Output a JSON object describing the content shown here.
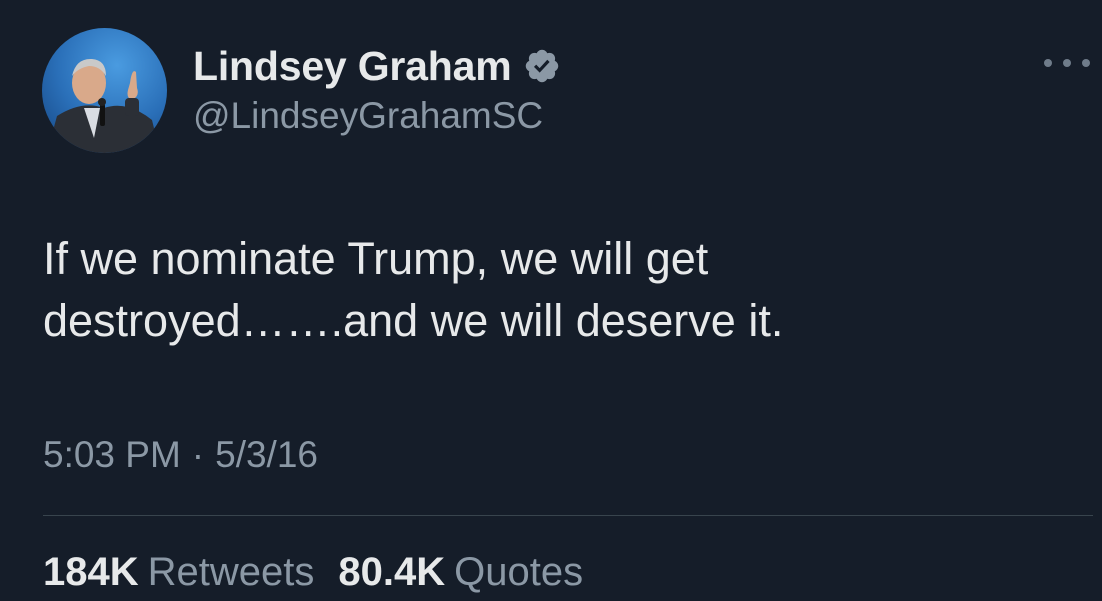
{
  "author": {
    "display_name": "Lindsey Graham",
    "handle": "@LindseyGrahamSC",
    "verified": true
  },
  "tweet": {
    "text": "If we nominate Trump, we will get\ndestroyed…….and we will deserve it.",
    "time": "5:03 PM",
    "separator": "·",
    "date": "5/3/16"
  },
  "stats": {
    "retweets_count": "184K",
    "retweets_label": "Retweets",
    "quotes_count": "80.4K",
    "quotes_label": "Quotes"
  },
  "colors": {
    "background": "#151d29",
    "primary_text": "#e7e9ea",
    "secondary_text": "#8b98a5",
    "verified_badge": "#8b98a5",
    "divider": "#38444d"
  },
  "icons": {
    "verified": "verified-badge-icon",
    "more": "more-horizontal-icon"
  }
}
